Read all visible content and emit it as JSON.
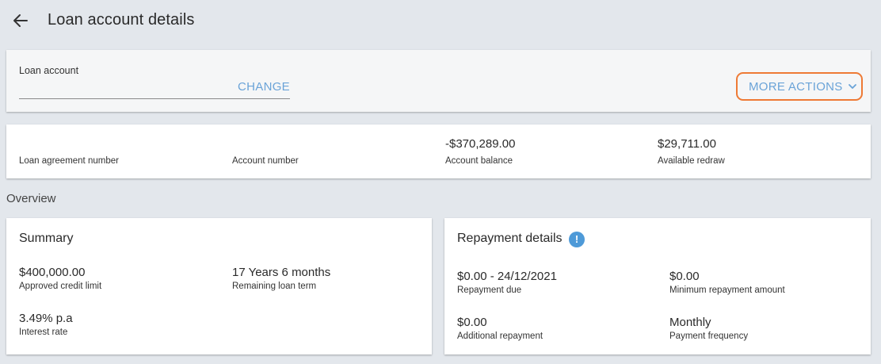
{
  "header": {
    "title": "Loan account details",
    "back_icon": "arrow-left-icon"
  },
  "account": {
    "label": "Loan account",
    "value": "",
    "change_label": "CHANGE",
    "more_actions_label": "MORE ACTIONS",
    "more_actions_icon": "chevron-down-icon",
    "accent_color": "#ee7a35",
    "link_color": "#6aa3d8"
  },
  "info": {
    "items": [
      {
        "label": "Loan agreement number",
        "value": ""
      },
      {
        "label": "Account number",
        "value": ""
      },
      {
        "label": "Account balance",
        "value": "-$370,289.00"
      },
      {
        "label": "Available redraw",
        "value": "$29,711.00"
      }
    ]
  },
  "overview": {
    "title": "Overview"
  },
  "summary": {
    "title": "Summary",
    "approved_credit_limit": {
      "value": "$400,000.00",
      "label": "Approved credit limit"
    },
    "remaining_loan_term": {
      "value": "17 Years 6 months",
      "label": "Remaining loan term"
    },
    "interest_rate": {
      "value": "3.49% p.a",
      "label": "Interest rate"
    }
  },
  "repayment": {
    "title": "Repayment details",
    "info_icon": "info-icon",
    "repayment_due": {
      "value": "$0.00 - 24/12/2021",
      "label": "Repayment due"
    },
    "minimum_repayment": {
      "value": "$0.00",
      "label": "Minimum repayment amount"
    },
    "additional_repayment": {
      "value": "$0.00",
      "label": "Additional repayment"
    },
    "payment_frequency": {
      "value": "Monthly",
      "label": "Payment frequency"
    }
  }
}
